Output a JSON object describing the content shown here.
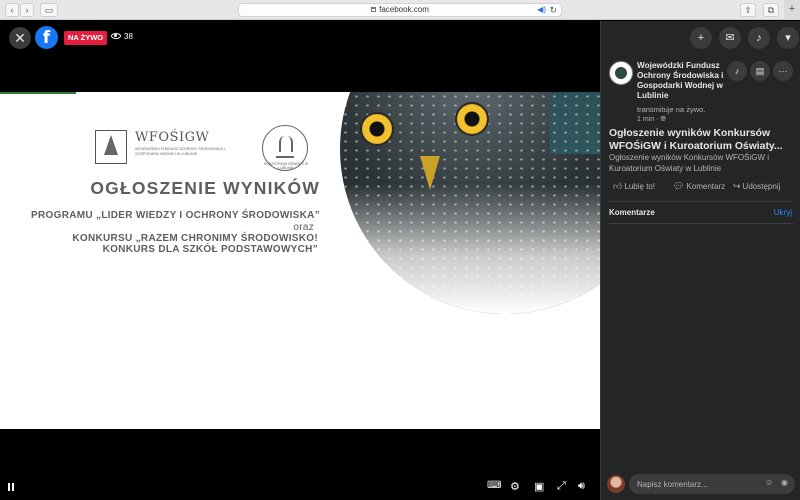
{
  "browser": {
    "url": "facebook.com",
    "new_tab_icon": "plus-icon"
  },
  "video": {
    "live_label": "NA ŻYWO",
    "viewer_count": "38",
    "slide": {
      "logo_name": "WFOŚIGW",
      "logo_sub": "Wojewódzki Fundusz Ochrony Środowiska i Gospodarki Wodnej w Lublinie",
      "kuratorium_text": "KURATORIUM OŚWIATY W LUBLINIE",
      "heading": "OGŁOSZENIE WYNIKÓW",
      "line1": "PROGRAMU „LIDER WIEDZY I OCHRONY ŚRODOWISKA”",
      "line2": "oraz",
      "line3": "KONKURSU „RAZEM CHRONIMY ŚRODOWISKO!",
      "line4": "KONKURS DLA SZKÓŁ PODSTAWOWYCH”"
    }
  },
  "panel": {
    "page_name": "Wojewódzki Fundusz Ochrony Środowiska i Gospodarki Wodnej w Lublinie",
    "status": "transmituje na żywo.",
    "time_ago": "1 min · ",
    "post_title": "Ogłoszenie wyników Konkursów WFOŚiGW i Kuroatorium Oświaty...",
    "post_desc": "Ogłoszenie wyników Konkursów WFOŚiGW i Kuroatorium Oświaty w Lublinie",
    "like_label": "Lubię to!",
    "comment_label": "Komentarz",
    "share_label": "Udostępnij",
    "comments_heading": "Komentarze",
    "hide_label": "Ukryj",
    "comment_placeholder": "Napisz komentarz..."
  }
}
